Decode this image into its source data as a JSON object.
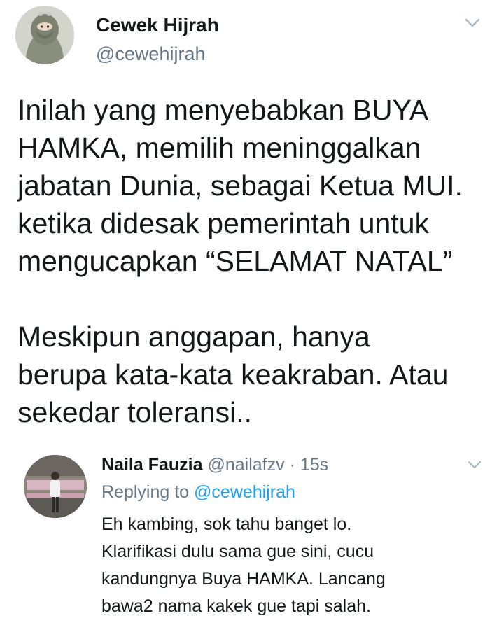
{
  "main_tweet": {
    "author_name": "Cewek Hijrah",
    "author_handle": "@cewehijrah",
    "menu_icon": "chevron-down-icon",
    "text_lines": [
      "Inilah yang menyebabkan BUYA",
      "HAMKA, memilih meninggalkan",
      "jabatan Dunia, sebagai Ketua MUI.",
      "ketika didesak pemerintah untuk",
      "mengucapkan “SELAMAT NATAL”",
      "",
      "Meskipun anggapan, hanya",
      "berupa kata-kata keakraban. Atau",
      "sekedar toleransi.."
    ]
  },
  "reply": {
    "author_name": "Naila Fauzia",
    "author_handle": "@nailafzv",
    "separator": "·",
    "time": "15s",
    "replying_label": "Replying to",
    "replying_to": "@cewehijrah",
    "menu_icon": "chevron-down-icon",
    "text_lines": [
      "Eh kambing, sok tahu banget lo.",
      "Klarifikasi dulu sama gue sini, cucu",
      "kandungnya Buya HAMKA. Lancang",
      "bawa2 nama kakek gue tapi salah."
    ]
  },
  "colors": {
    "text": "#14171a",
    "secondary": "#657786",
    "link": "#1da1f2",
    "background": "#ffffff"
  }
}
